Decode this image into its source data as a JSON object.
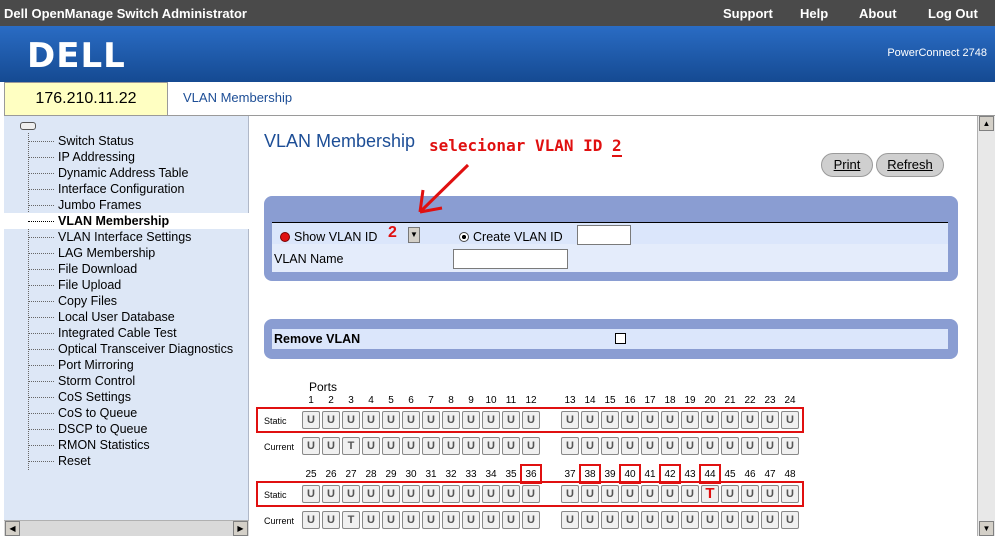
{
  "titlebar": {
    "app_title": "Dell OpenManage Switch Administrator",
    "menu": [
      "Support",
      "Help",
      "About",
      "Log Out"
    ]
  },
  "banner": {
    "logo_text": "DELL",
    "model": "PowerConnect 2748"
  },
  "device": {
    "ip": "176.210.11.22"
  },
  "breadcrumb": "VLAN Membership",
  "nav": {
    "items": [
      {
        "label": "Switch Status",
        "active": false
      },
      {
        "label": "IP Addressing",
        "active": false
      },
      {
        "label": "Dynamic Address Table",
        "active": false
      },
      {
        "label": "Interface Configuration",
        "active": false
      },
      {
        "label": "Jumbo Frames",
        "active": false
      },
      {
        "label": "VLAN Membership",
        "active": true
      },
      {
        "label": "VLAN Interface Settings",
        "active": false
      },
      {
        "label": "LAG Membership",
        "active": false
      },
      {
        "label": "File Download",
        "active": false
      },
      {
        "label": "File Upload",
        "active": false
      },
      {
        "label": "Copy Files",
        "active": false
      },
      {
        "label": "Local User Database",
        "active": false
      },
      {
        "label": "Integrated Cable Test",
        "active": false
      },
      {
        "label": "Optical Transceiver Diagnostics",
        "active": false
      },
      {
        "label": "Port Mirroring",
        "active": false
      },
      {
        "label": "Storm Control",
        "active": false
      },
      {
        "label": "CoS Settings",
        "active": false
      },
      {
        "label": "CoS to Queue",
        "active": false
      },
      {
        "label": "DSCP to Queue",
        "active": false
      },
      {
        "label": "RMON Statistics",
        "active": false
      },
      {
        "label": "Reset",
        "active": false
      }
    ]
  },
  "page": {
    "title": "VLAN Membership",
    "annotation_text": "selecionar VLAN ID",
    "annotation_value": "2",
    "print_label": "Print",
    "refresh_label": "Refresh",
    "show_vlan_label": "Show VLAN ID",
    "show_vlan_value": "2",
    "create_vlan_label": "Create VLAN ID",
    "create_vlan_value": "",
    "vlan_name_label": "VLAN Name",
    "vlan_name_value": "",
    "remove_vlan_label": "Remove VLAN",
    "remove_vlan_checked": false
  },
  "ports": {
    "label": "Ports",
    "static_label": "Static",
    "current_label": "Current",
    "row1": {
      "ports": [
        1,
        2,
        3,
        4,
        5,
        6,
        7,
        8,
        9,
        10,
        11,
        12,
        13,
        14,
        15,
        16,
        17,
        18,
        19,
        20,
        21,
        22,
        23,
        24
      ],
      "static": [
        "U",
        "U",
        "U",
        "U",
        "U",
        "U",
        "U",
        "U",
        "U",
        "U",
        "U",
        "U",
        "U",
        "U",
        "U",
        "U",
        "U",
        "U",
        "U",
        "U",
        "U",
        "U",
        "U",
        "U"
      ],
      "current": [
        "U",
        "U",
        "T",
        "U",
        "U",
        "U",
        "U",
        "U",
        "U",
        "U",
        "U",
        "U",
        "U",
        "U",
        "U",
        "U",
        "U",
        "U",
        "U",
        "U",
        "U",
        "U",
        "U",
        "U"
      ]
    },
    "row2": {
      "ports": [
        25,
        26,
        27,
        28,
        29,
        30,
        31,
        32,
        33,
        34,
        35,
        36,
        37,
        38,
        39,
        40,
        41,
        42,
        43,
        44,
        45,
        46,
        47,
        48
      ],
      "static": [
        "U",
        "U",
        "U",
        "U",
        "U",
        "U",
        "U",
        "U",
        "U",
        "U",
        "U",
        "U",
        "U",
        "U",
        "U",
        "U",
        "U",
        "U",
        "U",
        "T",
        "U",
        "U",
        "U",
        "U"
      ],
      "current": [
        "U",
        "U",
        "T",
        "U",
        "U",
        "U",
        "U",
        "U",
        "U",
        "U",
        "U",
        "U",
        "U",
        "U",
        "U",
        "U",
        "U",
        "U",
        "U",
        "U",
        "U",
        "U",
        "U",
        "U"
      ]
    },
    "highlighted_ports": [
      36,
      38,
      40,
      42,
      44
    ],
    "highlight_color": "#e01010"
  }
}
